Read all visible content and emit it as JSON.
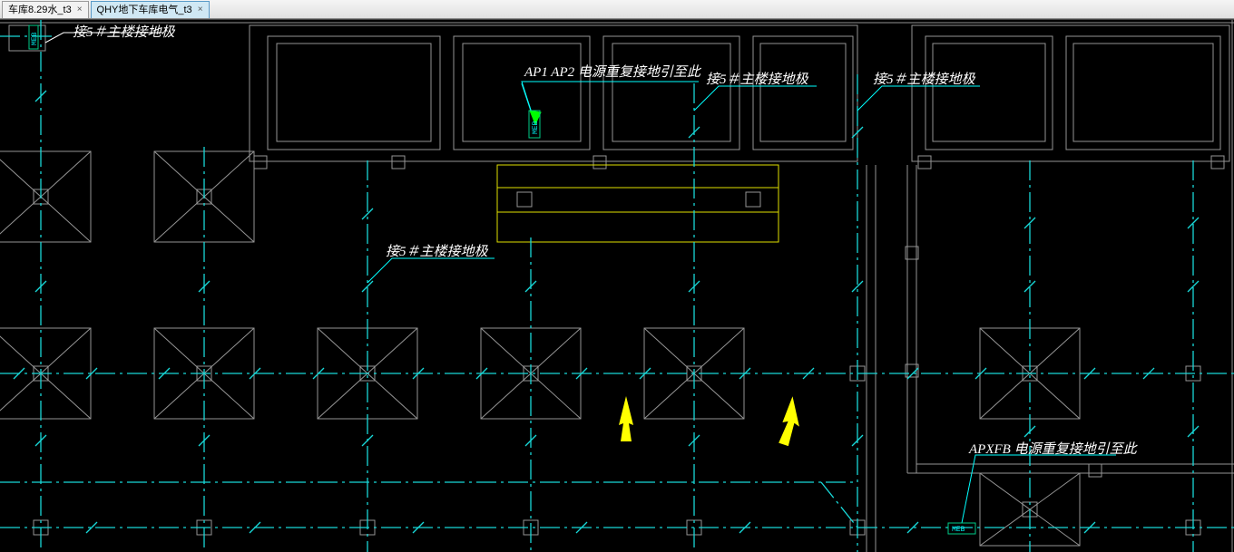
{
  "tabs": [
    {
      "label": "车库8.29水_t3",
      "active": false
    },
    {
      "label": "QHY地下车库电气_t3",
      "active": true
    }
  ],
  "annotations": {
    "top_left": "接5＃主楼接地极",
    "top_center": "AP1 AP2 电源重复接地引至此",
    "top_right1": "接5＃主楼接地极",
    "top_right2": "接5＃主楼接地极",
    "mid": "接5＃主楼接地极",
    "bottom_right": "APXFB 电源重复接地引至此"
  },
  "meb": "MEB",
  "colors": {
    "ground": "#18d8d8",
    "struct": "#959595",
    "room": "#e0e000",
    "arrow": "#ffff00",
    "leader": "#00ffff"
  }
}
